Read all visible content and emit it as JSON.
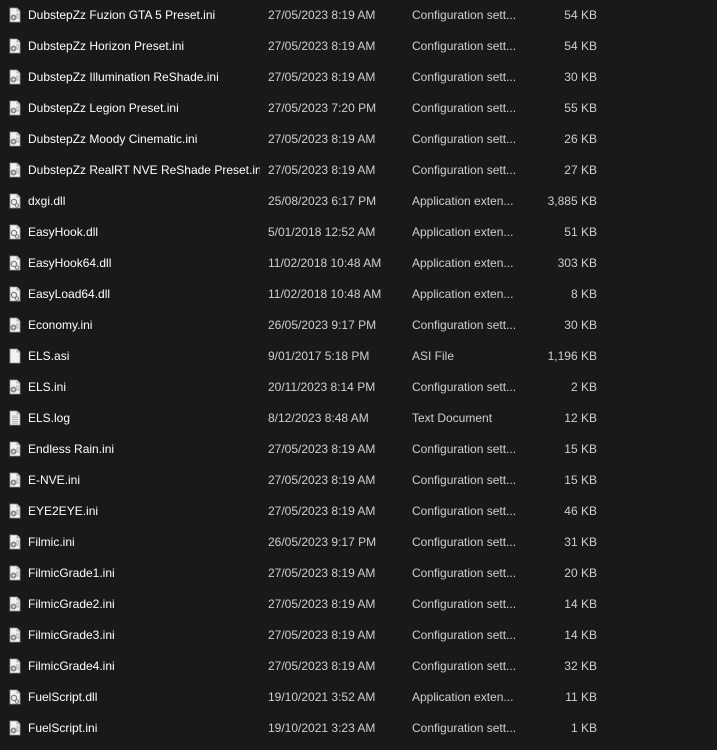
{
  "files": [
    {
      "name": "DubstepZz Fuzion GTA 5 Preset.ini",
      "date": "27/05/2023 8:19 AM",
      "type": "Configuration sett...",
      "size": "54 KB",
      "icon": "config-file-icon"
    },
    {
      "name": "DubstepZz Horizon Preset.ini",
      "date": "27/05/2023 8:19 AM",
      "type": "Configuration sett...",
      "size": "54 KB",
      "icon": "config-file-icon"
    },
    {
      "name": "DubstepZz Illumination ReShade.ini",
      "date": "27/05/2023 8:19 AM",
      "type": "Configuration sett...",
      "size": "30 KB",
      "icon": "config-file-icon"
    },
    {
      "name": "DubstepZz Legion Preset.ini",
      "date": "27/05/2023 7:20 PM",
      "type": "Configuration sett...",
      "size": "55 KB",
      "icon": "config-file-icon"
    },
    {
      "name": "DubstepZz Moody Cinematic.ini",
      "date": "27/05/2023 8:19 AM",
      "type": "Configuration sett...",
      "size": "26 KB",
      "icon": "config-file-icon"
    },
    {
      "name": "DubstepZz RealRT NVE ReShade Preset.ini",
      "date": "27/05/2023 8:19 AM",
      "type": "Configuration sett...",
      "size": "27 KB",
      "icon": "config-file-icon"
    },
    {
      "name": "dxgi.dll",
      "date": "25/08/2023 6:17 PM",
      "type": "Application exten...",
      "size": "3,885 KB",
      "icon": "dll-file-icon"
    },
    {
      "name": "EasyHook.dll",
      "date": "5/01/2018 12:52 AM",
      "type": "Application exten...",
      "size": "51 KB",
      "icon": "dll-file-icon"
    },
    {
      "name": "EasyHook64.dll",
      "date": "11/02/2018 10:48 AM",
      "type": "Application exten...",
      "size": "303 KB",
      "icon": "dll-file-icon"
    },
    {
      "name": "EasyLoad64.dll",
      "date": "11/02/2018 10:48 AM",
      "type": "Application exten...",
      "size": "8 KB",
      "icon": "dll-file-icon"
    },
    {
      "name": "Economy.ini",
      "date": "26/05/2023 9:17 PM",
      "type": "Configuration sett...",
      "size": "30 KB",
      "icon": "config-file-icon"
    },
    {
      "name": "ELS.asi",
      "date": "9/01/2017 5:18 PM",
      "type": "ASI File",
      "size": "1,196 KB",
      "icon": "blank-file-icon"
    },
    {
      "name": "ELS.ini",
      "date": "20/11/2023 8:14 PM",
      "type": "Configuration sett...",
      "size": "2 KB",
      "icon": "config-file-icon"
    },
    {
      "name": "ELS.log",
      "date": "8/12/2023 8:48 AM",
      "type": "Text Document",
      "size": "12 KB",
      "icon": "text-file-icon"
    },
    {
      "name": "Endless Rain.ini",
      "date": "27/05/2023 8:19 AM",
      "type": "Configuration sett...",
      "size": "15 KB",
      "icon": "config-file-icon"
    },
    {
      "name": "E-NVE.ini",
      "date": "27/05/2023 8:19 AM",
      "type": "Configuration sett...",
      "size": "15 KB",
      "icon": "config-file-icon"
    },
    {
      "name": "EYE2EYE.ini",
      "date": "27/05/2023 8:19 AM",
      "type": "Configuration sett...",
      "size": "46 KB",
      "icon": "config-file-icon"
    },
    {
      "name": "Filmic.ini",
      "date": "26/05/2023 9:17 PM",
      "type": "Configuration sett...",
      "size": "31 KB",
      "icon": "config-file-icon"
    },
    {
      "name": "FilmicGrade1.ini",
      "date": "27/05/2023 8:19 AM",
      "type": "Configuration sett...",
      "size": "20 KB",
      "icon": "config-file-icon"
    },
    {
      "name": "FilmicGrade2.ini",
      "date": "27/05/2023 8:19 AM",
      "type": "Configuration sett...",
      "size": "14 KB",
      "icon": "config-file-icon"
    },
    {
      "name": "FilmicGrade3.ini",
      "date": "27/05/2023 8:19 AM",
      "type": "Configuration sett...",
      "size": "14 KB",
      "icon": "config-file-icon"
    },
    {
      "name": "FilmicGrade4.ini",
      "date": "27/05/2023 8:19 AM",
      "type": "Configuration sett...",
      "size": "32 KB",
      "icon": "config-file-icon"
    },
    {
      "name": "FuelScript.dll",
      "date": "19/10/2021 3:52 AM",
      "type": "Application exten...",
      "size": "11 KB",
      "icon": "dll-file-icon"
    },
    {
      "name": "FuelScript.ini",
      "date": "19/10/2021 3:23 AM",
      "type": "Configuration sett...",
      "size": "1 KB",
      "icon": "config-file-icon"
    }
  ]
}
